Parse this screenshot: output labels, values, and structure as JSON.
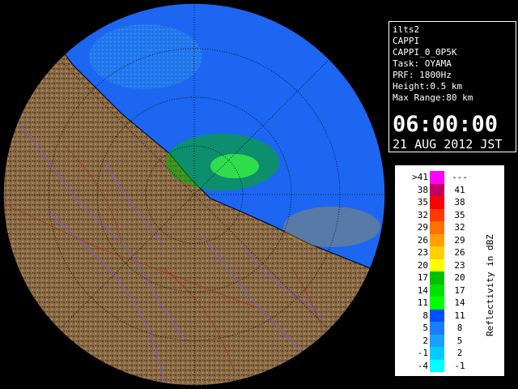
{
  "info": {
    "station": "ilts2",
    "product": "CAPPI",
    "product_name": "CAPPI_0_0P5K",
    "task": "Task: OYAMA",
    "prf": "PRF: 1800Hz",
    "height": "Height:0.5 km",
    "max_range": "Max Range:80 km",
    "time": "06:00:00",
    "date": "21 AUG 2012 JST"
  },
  "legend": {
    "unit_label": "Reflectivity in dBZ",
    "rows": [
      {
        "lo": ">41",
        "hi": "---",
        "color": "#ff00ff"
      },
      {
        "lo": "38",
        "hi": "41",
        "color": "#c00060"
      },
      {
        "lo": "35",
        "hi": "38",
        "color": "#ff0000"
      },
      {
        "lo": "32",
        "hi": "35",
        "color": "#ff3a00"
      },
      {
        "lo": "29",
        "hi": "32",
        "color": "#ff7000"
      },
      {
        "lo": "26",
        "hi": "29",
        "color": "#ffa000"
      },
      {
        "lo": "23",
        "hi": "26",
        "color": "#ffd000"
      },
      {
        "lo": "20",
        "hi": "23",
        "color": "#ffff00"
      },
      {
        "lo": "17",
        "hi": "20",
        "color": "#00c000"
      },
      {
        "lo": "14",
        "hi": "17",
        "color": "#00e000"
      },
      {
        "lo": "11",
        "hi": "14",
        "color": "#00ff00"
      },
      {
        "lo": "8",
        "hi": "11",
        "color": "#0050ff"
      },
      {
        "lo": "5",
        "hi": "8",
        "color": "#1a7cff"
      },
      {
        "lo": "2",
        "hi": "5",
        "color": "#1aa0ff"
      },
      {
        "lo": "-1",
        "hi": "2",
        "color": "#00ccff"
      },
      {
        "lo": "-4",
        "hi": "-1",
        "color": "#00ffff"
      }
    ]
  },
  "colors": {
    "sea": "#1f6cff",
    "land": "#8a6a45",
    "coast_outline": "#000000"
  }
}
